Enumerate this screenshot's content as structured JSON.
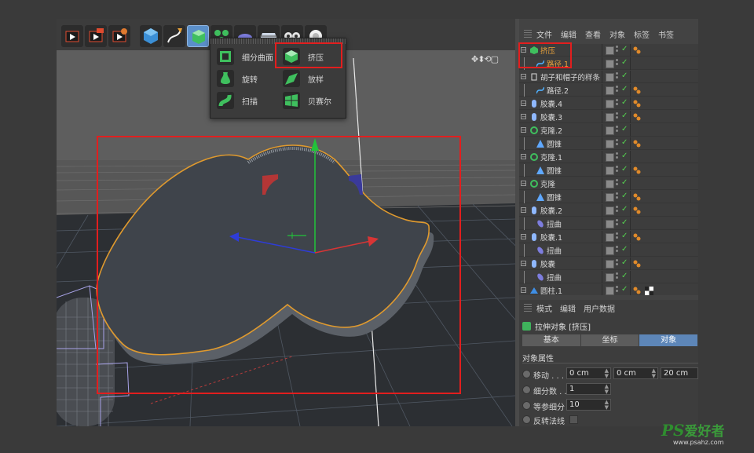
{
  "toolbar": {
    "buttons": [
      {
        "icon": "render-view-icon"
      },
      {
        "icon": "render-to-picture-viewer-icon"
      },
      {
        "icon": "render-settings-icon"
      },
      {
        "icon": "cube-primitive-icon"
      },
      {
        "icon": "pen-spline-icon"
      },
      {
        "icon": "generator-nurbs-icon",
        "active": true
      },
      {
        "icon": "array-cloner-icon"
      },
      {
        "icon": "deformer-icon"
      },
      {
        "icon": "floor-environment-icon"
      },
      {
        "icon": "camera-icon"
      },
      {
        "icon": "light-icon"
      }
    ]
  },
  "popup": {
    "items": [
      {
        "label": "细分曲面",
        "icon": "subdivision-surface-icon"
      },
      {
        "label": "挤压",
        "icon": "extrude-icon",
        "highlighted": true
      },
      {
        "label": "旋转",
        "icon": "lathe-icon"
      },
      {
        "label": "放样",
        "icon": "loft-icon"
      },
      {
        "label": "扫描",
        "icon": "sweep-icon"
      },
      {
        "label": "贝赛尔",
        "icon": "bezier-icon"
      }
    ]
  },
  "viewport": {
    "nav_icons": "✥⬍⟲▢"
  },
  "object_manager": {
    "menu": [
      "文件",
      "编辑",
      "查看",
      "对象",
      "标签",
      "书签"
    ],
    "objects": [
      {
        "name": "挤压",
        "depth": 0,
        "icon": "extrude",
        "selected": true,
        "tag": true
      },
      {
        "name": "路径.1",
        "depth": 1,
        "icon": "spline",
        "selected": true
      },
      {
        "name": "胡子和帽子的样条",
        "depth": 0,
        "icon": "null"
      },
      {
        "name": "路径.2",
        "depth": 1,
        "icon": "spline",
        "tag": true
      },
      {
        "name": "胶囊.4",
        "depth": 0,
        "icon": "capsule",
        "tag": true
      },
      {
        "name": "胶囊.3",
        "depth": 0,
        "icon": "capsule",
        "tag": true
      },
      {
        "name": "克隆.2",
        "depth": 0,
        "icon": "cloner"
      },
      {
        "name": "圆锥",
        "depth": 1,
        "icon": "cone",
        "tag": true
      },
      {
        "name": "克隆.1",
        "depth": 0,
        "icon": "cloner"
      },
      {
        "name": "圆锥",
        "depth": 1,
        "icon": "cone",
        "tag": true
      },
      {
        "name": "克隆",
        "depth": 0,
        "icon": "cloner"
      },
      {
        "name": "圆锥",
        "depth": 1,
        "icon": "cone",
        "tag": true
      },
      {
        "name": "胶囊.2",
        "depth": 0,
        "icon": "capsule",
        "tag": true
      },
      {
        "name": "扭曲",
        "depth": 1,
        "icon": "bend"
      },
      {
        "name": "胶囊.1",
        "depth": 0,
        "icon": "capsule",
        "tag": true
      },
      {
        "name": "扭曲",
        "depth": 1,
        "icon": "bend"
      },
      {
        "name": "胶囊",
        "depth": 0,
        "icon": "capsule",
        "tag": true
      },
      {
        "name": "扭曲",
        "depth": 1,
        "icon": "bend"
      },
      {
        "name": "圆柱.1",
        "depth": 0,
        "icon": "cylinder",
        "tag": true,
        "checker": true
      }
    ]
  },
  "attributes": {
    "menu": [
      "模式",
      "编辑",
      "用户数据"
    ],
    "title": "拉伸对象 [挤压]",
    "tabs": [
      {
        "label": "基本",
        "active": false
      },
      {
        "label": "坐标",
        "active": false
      },
      {
        "label": "对象",
        "active": true
      }
    ],
    "section": "对象属性",
    "props": {
      "move_label": "移动 . . . .",
      "move_x": "0 cm",
      "move_y": "0 cm",
      "move_z": "20 cm",
      "subdiv_label": "细分数 . .",
      "subdiv_value": "1",
      "iso_label": "等参细分",
      "iso_value": "10",
      "flip_label": "反转法线"
    }
  },
  "watermark": {
    "ps": "PS",
    "cn": "爱好者",
    "url": "www.psahz.com"
  },
  "colors": {
    "highlight_red": "#e21e1e",
    "selection_orange": "#e9a23b",
    "active_tab_blue": "#5d86b8",
    "check_green": "#55d14f"
  }
}
